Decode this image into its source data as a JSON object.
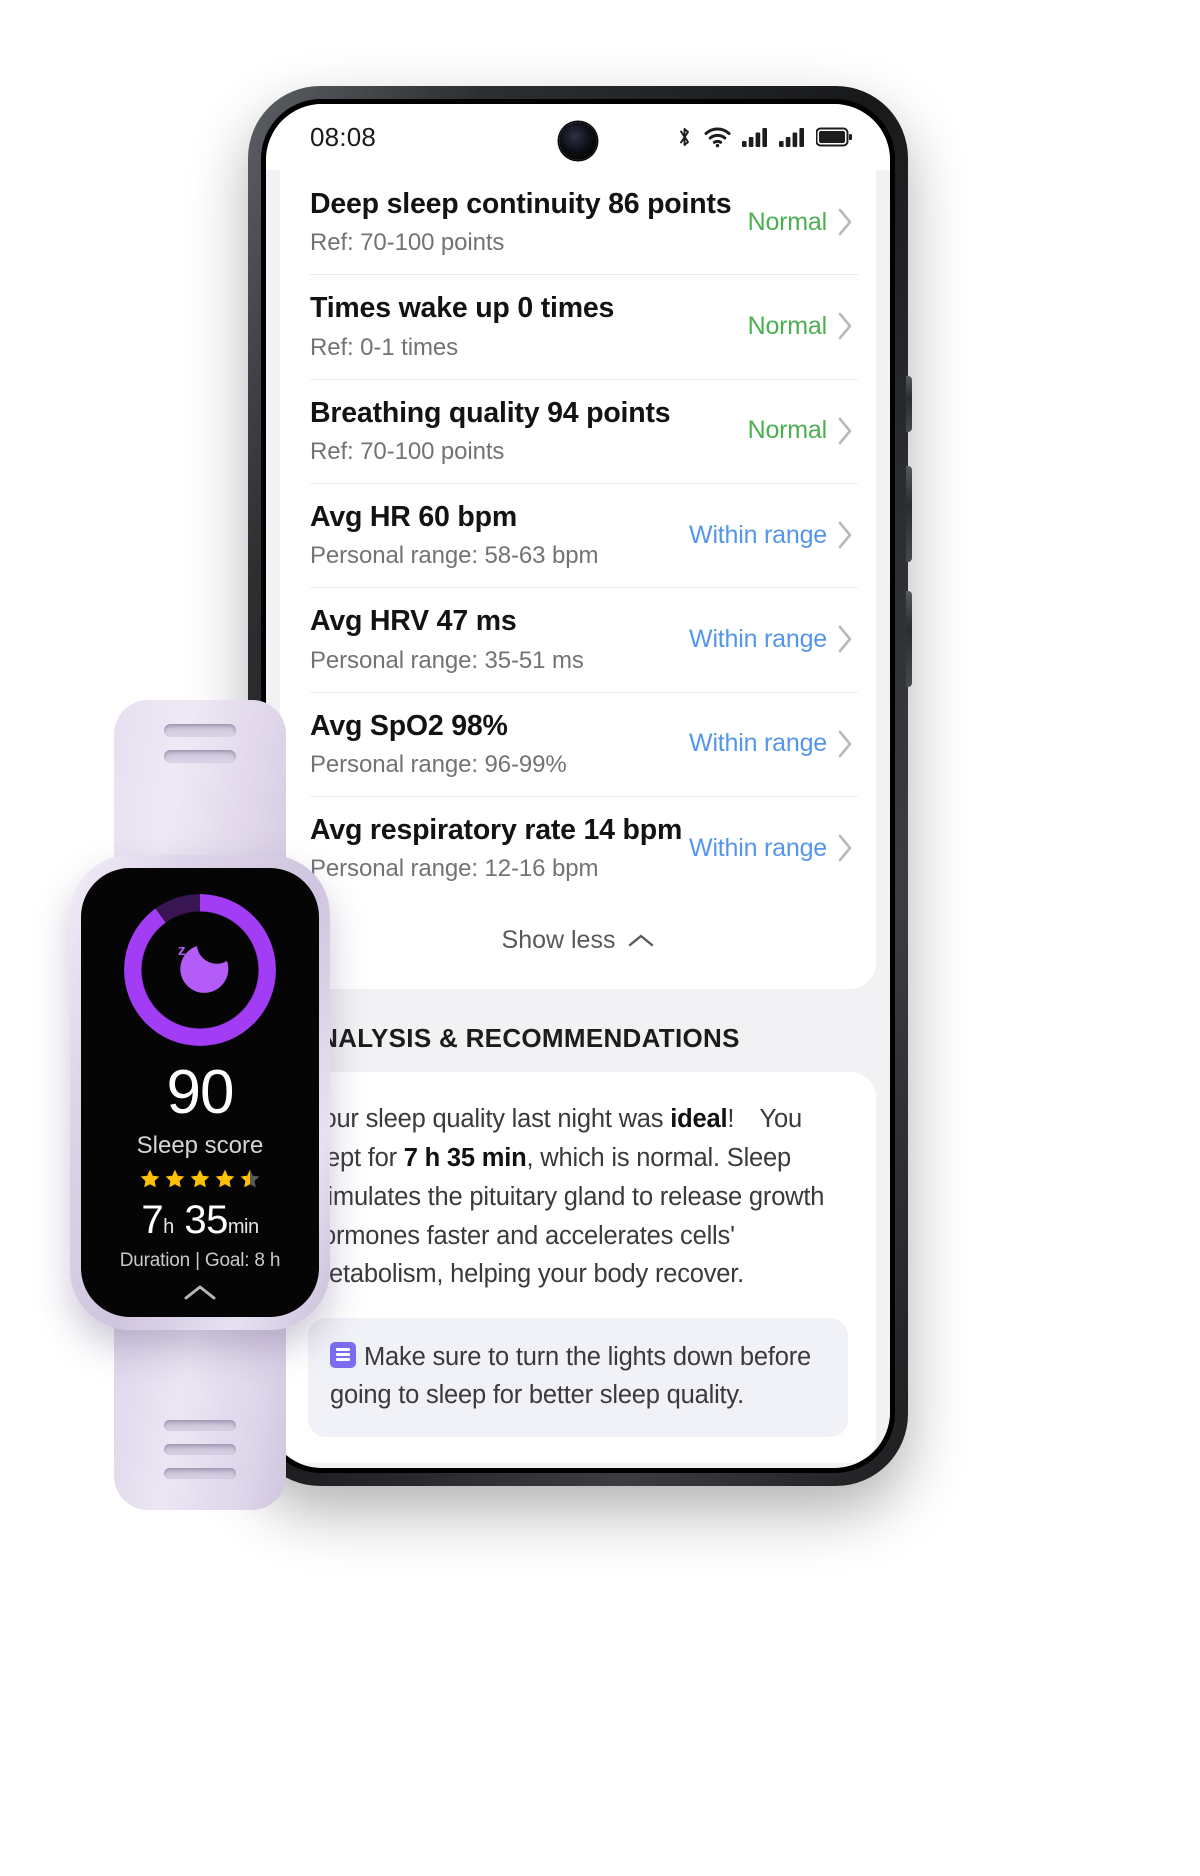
{
  "phone": {
    "status_bar": {
      "time": "08:08",
      "icons": [
        "bluetooth-icon",
        "wifi-icon",
        "signal-bars-icon",
        "signal-bars-2-icon",
        "battery-icon"
      ]
    }
  },
  "metrics": {
    "rows": [
      {
        "title": "Deep sleep continuity 86 points",
        "sub": "Ref: 70-100 points",
        "status": "Normal",
        "status_kind": "normal"
      },
      {
        "title": "Times wake up 0 times",
        "sub": "Ref: 0-1 times",
        "status": "Normal",
        "status_kind": "normal"
      },
      {
        "title": "Breathing quality 94 points",
        "sub": "Ref: 70-100 points",
        "status": "Normal",
        "status_kind": "normal"
      },
      {
        "title": "Avg HR 60 bpm",
        "sub": "Personal range: 58-63 bpm",
        "status": "Within range",
        "status_kind": "within"
      },
      {
        "title": "Avg HRV 47 ms",
        "sub": "Personal range: 35-51 ms",
        "status": "Within range",
        "status_kind": "within"
      },
      {
        "title": "Avg SpO2 98%",
        "sub": "Personal range: 96-99%",
        "status": "Within range",
        "status_kind": "within"
      },
      {
        "title": "Avg respiratory rate 14 bpm",
        "sub": "Personal range: 12-16 bpm",
        "status": "Within range",
        "status_kind": "within"
      }
    ],
    "show_less_label": "Show less"
  },
  "analysis": {
    "heading": "ANALYSIS & RECOMMENDATIONS",
    "body_1": "Your sleep quality last night was ",
    "body_bold_1": "ideal",
    "body_2": "! You slept for ",
    "body_bold_2": "7 h 35 min",
    "body_3": ", which is normal. Sleep stimulates the pituitary gland to release growth hormones faster and accelerates cells' metabolism, helping your body recover.",
    "tip": "Make sure to turn the lights down before going to sleep for better sleep quality."
  },
  "watch": {
    "score": "90",
    "score_label": "Sleep score",
    "stars_filled": 4,
    "stars_half": 1,
    "stars_total": 5,
    "duration_hours": "7",
    "duration_hours_unit": "h",
    "duration_minutes": "35",
    "duration_minutes_unit": "min",
    "goal_line": "Duration  |  Goal: 8 h",
    "ring_percent": 90,
    "ring_color": "#a23cf5"
  },
  "colors": {
    "normal": "#4cb050",
    "within_range": "#5596ec",
    "accent_purple": "#a23cf5",
    "tip_icon": "#7c6df0"
  }
}
